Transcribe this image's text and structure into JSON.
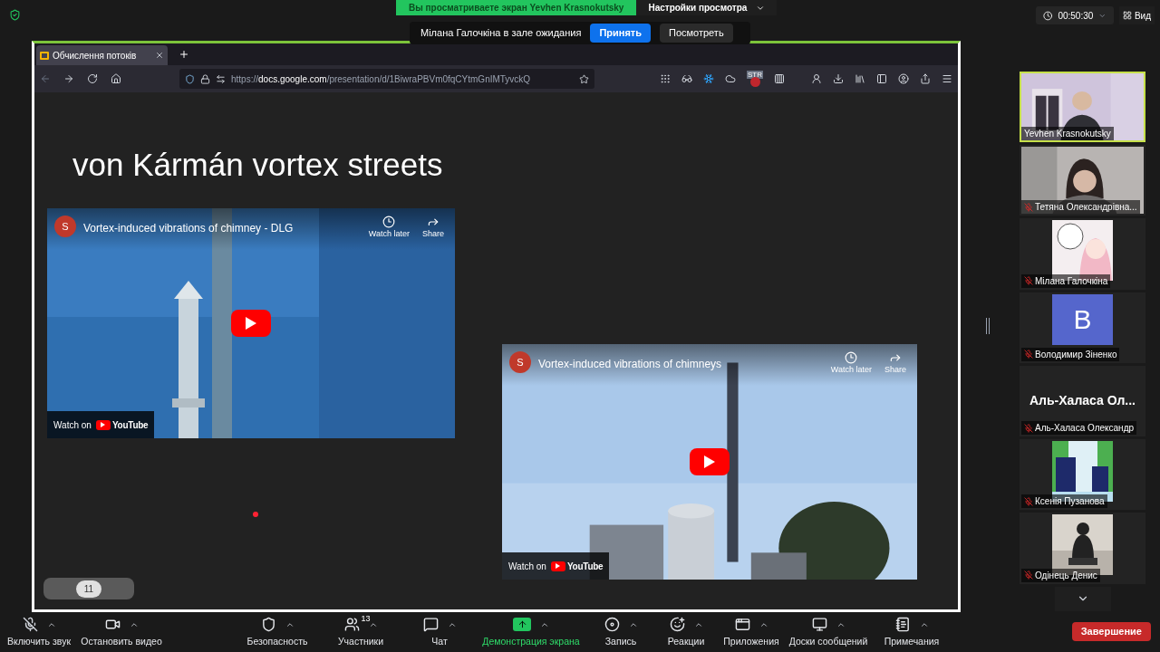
{
  "share_banner": {
    "text": "Вы просматриваете экран Yevhen Krasnokutsky",
    "view_options": "Настройки просмотра"
  },
  "waiting_notice": {
    "text": "Мілана Галочкіна в зале ожидания",
    "buttons": [
      {
        "label": "Принять",
        "kind": "primary"
      },
      {
        "label": "Посмотреть",
        "kind": "secondary"
      }
    ]
  },
  "meeting_timer": "00:50:30",
  "view_button": "Вид",
  "browser": {
    "tab_title": "Обчислення потоків",
    "url": "https://**docs.google.com**/presentation/d/1BiwraPBVm0fqCYtmGnIMTyvckQ",
    "extension_badge": "STR"
  },
  "slide": {
    "title": "von Kármán vortex streets",
    "page": "11",
    "videos": [
      {
        "channel_initial": "S",
        "title": "Vortex-induced vibrations of chimney - DLG",
        "watch_later": "Watch later",
        "share": "Share",
        "watch_on": "Watch on",
        "platform": "YouTube"
      },
      {
        "channel_initial": "S",
        "title": "Vortex-induced vibrations of chimneys",
        "watch_later": "Watch later",
        "share": "Share",
        "watch_on": "Watch on",
        "platform": "YouTube"
      }
    ]
  },
  "participants": [
    {
      "name": "Yevhen Krasnokutsky",
      "kind": "camera",
      "muted": false,
      "speaking": true
    },
    {
      "name": "Тетяна Олександрівна...",
      "kind": "camera",
      "muted": true,
      "speaking": false
    },
    {
      "name": "Мілана Галочкіна",
      "muted": true,
      "speaking": false
    },
    {
      "name": "Володимир Зіненко",
      "kind": "letter",
      "letter": "В",
      "muted": true,
      "speaking": false
    },
    {
      "name": "Аль-Халаса Олександр",
      "kind": "name",
      "display_name": "Аль-Халаса  Ол...",
      "muted": true,
      "speaking": false
    },
    {
      "name": "Ксенія Пузанова",
      "muted": true,
      "speaking": false
    },
    {
      "name": "Одінець Денис",
      "muted": true,
      "speaking": false
    }
  ],
  "toolbar": [
    {
      "label": "Включить звук",
      "highlighted": false
    },
    {
      "label": "Остановить видео",
      "highlighted": false
    },
    {
      "label": "Безопасность",
      "highlighted": false
    },
    {
      "label": "Участники",
      "count": "13",
      "highlighted": false
    },
    {
      "label": "Чат",
      "highlighted": false
    },
    {
      "label": "Демонстрация экрана",
      "highlighted": true
    },
    {
      "label": "Запись",
      "highlighted": false
    },
    {
      "label": "Реакции",
      "highlighted": false
    },
    {
      "label": "Приложения",
      "highlighted": false
    },
    {
      "label": "Доски сообщений",
      "highlighted": false
    },
    {
      "label": "Примечания",
      "highlighted": false
    }
  ],
  "end_button": "Завершение"
}
